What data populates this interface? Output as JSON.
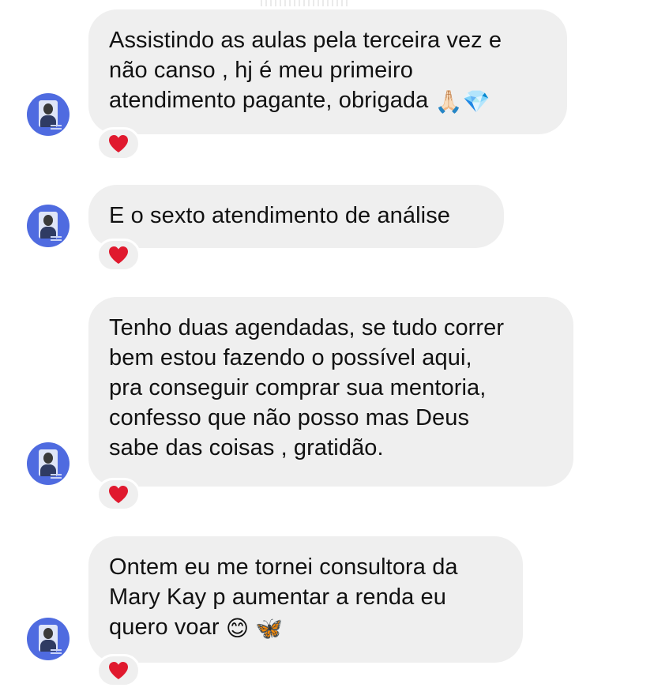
{
  "thread": {
    "messages": [
      {
        "text": "Assistindo as aulas pela terceira vez e\nnão canso , hj é meu primeiro\natendimento pagante, obrigada",
        "emojis": [
          "🙏🏻",
          "💎"
        ],
        "reaction": "heart-icon"
      },
      {
        "text": "E o sexto atendimento de análise",
        "emojis": [],
        "reaction": "heart-icon"
      },
      {
        "text": "Tenho duas agendadas, se tudo correr\nbem estou fazendo o possível aqui,\npra conseguir comprar sua mentoria,\nconfesso que não posso mas Deus\nsabe das coisas , gratidão.",
        "emojis": [],
        "reaction": "heart-icon"
      },
      {
        "text": "Ontem eu me tornei consultora da\nMary Kay p aumentar a renda eu\nquero voar",
        "emojis": [
          "😊",
          "🦋"
        ],
        "reaction": "heart-icon"
      }
    ]
  },
  "colors": {
    "bubble": "#efefef",
    "avatar": "#4f6be0",
    "heart": "#e0192e",
    "text": "#111111"
  }
}
